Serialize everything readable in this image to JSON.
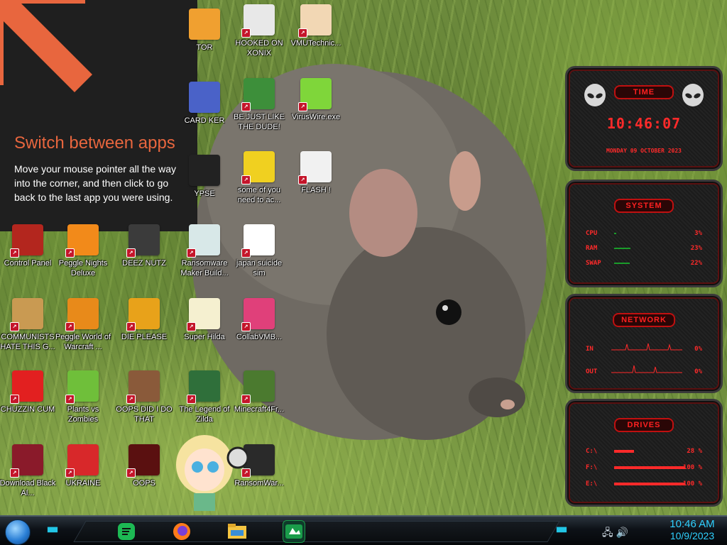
{
  "tip": {
    "title": "Switch between apps",
    "body": "Move your mouse pointer all the way into the corner, and then click to go back to the last app you were using."
  },
  "icons": [
    {
      "label": "HOOKED ON XONIX",
      "icon": "xonix-icon",
      "color": "#e8e8e8"
    },
    {
      "label": "VMUTechnic...",
      "icon": "doctor-icon",
      "color": "#f2d7b4"
    },
    {
      "label": "BE JUST LIKE THE DUDE!",
      "icon": "santa-icon",
      "color": "#3d8f3a"
    },
    {
      "label": "VirusWire.exe",
      "icon": "lime-icon",
      "color": "#7fd63a"
    },
    {
      "label": "some of you need to ac...",
      "icon": "dog-icon",
      "color": "#f0d020"
    },
    {
      "label": "FLASH !",
      "icon": "document-icon",
      "color": "#f1f1f1"
    },
    {
      "label": "japan suicide sim",
      "icon": "game-icon",
      "color": "#ffffff"
    },
    {
      "label": "Control Panel",
      "icon": "control-panel-icon",
      "color": "#b3261e"
    },
    {
      "label": "Peggle Nights Deluxe",
      "icon": "peggle-icon",
      "color": "#f28a1a"
    },
    {
      "label": "DEEZ NUTZ",
      "icon": "folder-stack-icon",
      "color": "#3b3b3b"
    },
    {
      "label": "Ransomware Maker Build...",
      "icon": "ransomware-icon",
      "color": "#d8e8e8"
    },
    {
      "label": "COMMUNISTS HATE THIS G...",
      "icon": "money-bag-icon",
      "color": "#c99a52"
    },
    {
      "label": "Peggle World of Warcraft ...",
      "icon": "peggle-wow-icon",
      "color": "#e88a1a"
    },
    {
      "label": "DIE PLEASE",
      "icon": "de-icon",
      "color": "#e8a21a"
    },
    {
      "label": "Super Hilda",
      "icon": "hilda-icon",
      "color": "#f5f0d0"
    },
    {
      "label": "CollabVMB...",
      "icon": "collab-icon",
      "color": "#e0407a"
    },
    {
      "label": "CHUZZIN CUM",
      "icon": "chuzzle-icon",
      "color": "#e22020"
    },
    {
      "label": "Plants vs Zombies",
      "icon": "plant-icon",
      "color": "#6fbf3a"
    },
    {
      "label": "OOPS DID I DO THAT",
      "icon": "portrait-icon",
      "color": "#8a5a3a"
    },
    {
      "label": "The Legend of Zilda",
      "icon": "zilda-icon",
      "color": "#2f6f3a"
    },
    {
      "label": "Minecraft4Fr...",
      "icon": "minecraft-icon",
      "color": "#4b7a2f"
    },
    {
      "label": "Download Black Al...",
      "icon": "black-orb-icon",
      "color": "#8a1a2a"
    },
    {
      "label": "UKRAINE",
      "icon": "radiation-icon",
      "color": "#d8282a"
    },
    {
      "label": "OOPS",
      "icon": "oops-icon",
      "color": "#5a1010"
    },
    {
      "label": "RansomWar...",
      "icon": "skull-icon",
      "color": "#2a2a2a"
    }
  ],
  "partial_icons": [
    {
      "label": "TOR",
      "color": "#f0a030"
    },
    {
      "label": "CARD KER",
      "color": "#4a62c8"
    },
    {
      "label": "YPSE",
      "color": "#222222"
    }
  ],
  "gadget": {
    "time_title": "TIME",
    "time": "10:46:07",
    "date": "MONDAY 09 OCTOBER 2023",
    "system_title": "SYSTEM",
    "system": [
      {
        "label": "CPU",
        "value": "3%",
        "fraction": 0.03
      },
      {
        "label": "RAM",
        "value": "23%",
        "fraction": 0.23
      },
      {
        "label": "SWAP",
        "value": "22%",
        "fraction": 0.22
      }
    ],
    "network_title": "NETWORK",
    "network": [
      {
        "label": "IN",
        "value": "0%"
      },
      {
        "label": "OUT",
        "value": "0%"
      }
    ],
    "drives_title": "DRIVES",
    "drives": [
      {
        "label": "C:\\",
        "value": "28 %",
        "fraction": 0.28
      },
      {
        "label": "F:\\",
        "value": "100 %",
        "fraction": 1.0
      },
      {
        "label": "E:\\",
        "value": "100 %",
        "fraction": 1.0
      }
    ]
  },
  "taskbar": {
    "apps": [
      {
        "name": "spotify-icon",
        "color": "#1db954"
      },
      {
        "name": "firefox-icon",
        "color": "#ff7b1a"
      },
      {
        "name": "file-explorer-icon",
        "color": "#f4c542"
      },
      {
        "name": "active-app-icon",
        "color": "#1a9c4a"
      }
    ],
    "time": "10:46 AM",
    "date": "10/9/2023"
  }
}
